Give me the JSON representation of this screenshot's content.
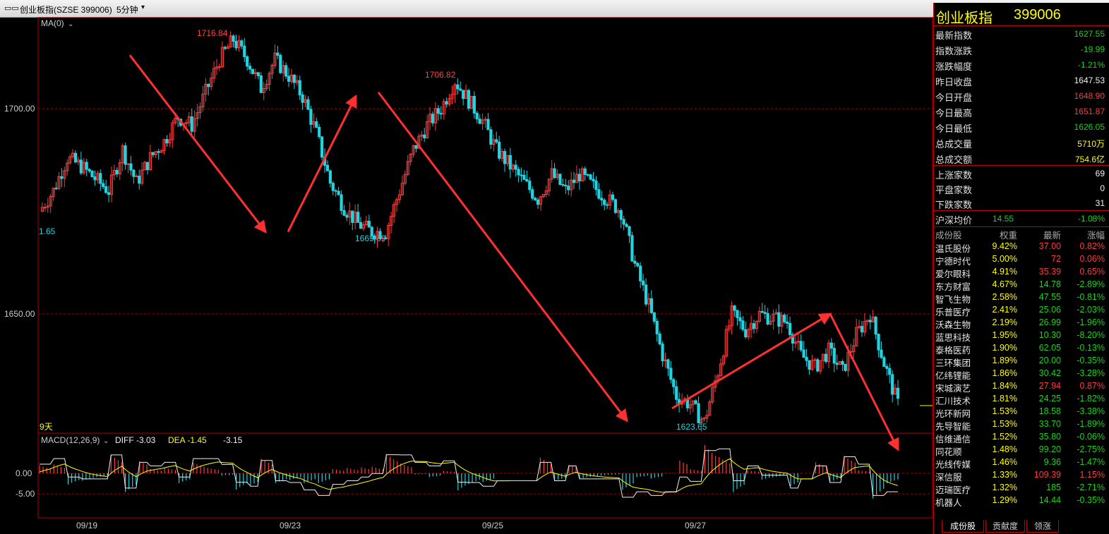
{
  "window": {
    "title": "创业板指(SZSE 399006)",
    "period": "5分钟"
  },
  "chart": {
    "ma_label": "MA(0)",
    "macd_label": "MACD(12,26,9)",
    "diff_label": "DIFF -3.03",
    "dea_label": "DEA -1.45",
    "macd_value": "-3.15",
    "span_label": "9天"
  },
  "chart_data": {
    "type": "candlestick",
    "price_axis": {
      "ticks": [
        "1700.00",
        "1650.00"
      ],
      "ylim": [
        1619,
        1732
      ]
    },
    "macd_axis": {
      "ticks": [
        "0.00",
        "-5.00"
      ]
    },
    "x_ticks": [
      "09/19",
      "09/23",
      "09/25",
      "09/27"
    ],
    "annotations": [
      {
        "text": "1716.84",
        "kind": "high"
      },
      {
        "text": "1669.89",
        "kind": "low"
      },
      {
        "text": "1706.82",
        "kind": "high"
      },
      {
        "text": "1623.65",
        "kind": "low"
      },
      {
        "text": "1.65",
        "kind": "left-edge"
      }
    ],
    "close_path": [
      1675,
      1680,
      1688,
      1686,
      1683,
      1680,
      1690,
      1682,
      1688,
      1692,
      1698,
      1696,
      1704,
      1712,
      1716.84,
      1712,
      1705,
      1712,
      1708,
      1703,
      1694,
      1682,
      1676,
      1672,
      1670,
      1669.89,
      1680,
      1690,
      1696,
      1700,
      1706.82,
      1702,
      1697,
      1690,
      1686,
      1682,
      1678,
      1684,
      1680,
      1684,
      1681,
      1678,
      1675,
      1662,
      1652,
      1640,
      1630,
      1628,
      1623.65,
      1636,
      1650,
      1646,
      1650,
      1649,
      1648,
      1640,
      1637,
      1641,
      1636,
      1645,
      1650,
      1638,
      1628
    ],
    "trend_arrows": [
      {
        "from": [
          4,
          1713
        ],
        "to": [
          10,
          1670
        ]
      },
      {
        "from": [
          11,
          1670
        ],
        "to": [
          14,
          1703
        ]
      },
      {
        "from": [
          15,
          1704
        ],
        "to": [
          26,
          1624
        ]
      },
      {
        "from": [
          28,
          1627
        ],
        "to": [
          35,
          1650
        ]
      },
      {
        "from": [
          35,
          1650
        ],
        "to": [
          38,
          1617
        ]
      }
    ]
  },
  "quote": {
    "name": "创业板指",
    "code": "399006",
    "fields": [
      {
        "label": "最新指数",
        "value": "1627.55",
        "color": "#19d419"
      },
      {
        "label": "指数涨跌",
        "value": "-19.99",
        "color": "#19d419"
      },
      {
        "label": "涨跌幅度",
        "value": "-1.21%",
        "color": "#19d419"
      },
      {
        "label": "昨日收盘",
        "value": "1647.53",
        "color": "#f0f0f0"
      },
      {
        "label": "今日开盘",
        "value": "1648.90",
        "color": "#ff3b3b"
      },
      {
        "label": "今日最高",
        "value": "1651.87",
        "color": "#ff3b3b"
      },
      {
        "label": "今日最低",
        "value": "1626.05",
        "color": "#19d419"
      },
      {
        "label": "总成交量",
        "value": "5710万",
        "color": "#ffff00"
      },
      {
        "label": "总成交额",
        "value": "754.6亿",
        "color": "#ffff00"
      }
    ],
    "breadth": [
      {
        "label": "上涨家数",
        "value": "69"
      },
      {
        "label": "平盘家数",
        "value": "0"
      },
      {
        "label": "下跌家数",
        "value": "31"
      }
    ],
    "avg": {
      "label": "沪深均价",
      "value": "14.55",
      "change": "-1.08%"
    }
  },
  "constituents": {
    "headers": [
      "成份股",
      "权重",
      "最新",
      "涨幅"
    ],
    "rows": [
      {
        "name": "温氏股份",
        "weight": "9.42%",
        "price": "37.00",
        "chg": "0.82%",
        "dir": "up"
      },
      {
        "name": "宁德时代",
        "weight": "5.00%",
        "price": "72",
        "chg": "0.06%",
        "dir": "up"
      },
      {
        "name": "爱尔眼科",
        "weight": "4.91%",
        "price": "35.39",
        "chg": "0.65%",
        "dir": "up"
      },
      {
        "name": "东方财富",
        "weight": "4.67%",
        "price": "14.78",
        "chg": "-2.89%",
        "dir": "dn"
      },
      {
        "name": "智飞生物",
        "weight": "2.58%",
        "price": "47.55",
        "chg": "-0.81%",
        "dir": "dn"
      },
      {
        "name": "乐普医疗",
        "weight": "2.41%",
        "price": "25.06",
        "chg": "-2.03%",
        "dir": "dn"
      },
      {
        "name": "沃森生物",
        "weight": "2.19%",
        "price": "26.99",
        "chg": "-1.96%",
        "dir": "dn"
      },
      {
        "name": "蓝思科技",
        "weight": "1.95%",
        "price": "10.30",
        "chg": "-8.20%",
        "dir": "dn"
      },
      {
        "name": "泰格医药",
        "weight": "1.90%",
        "price": "62.05",
        "chg": "-0.13%",
        "dir": "dn"
      },
      {
        "name": "三环集团",
        "weight": "1.89%",
        "price": "20.00",
        "chg": "-0.35%",
        "dir": "dn"
      },
      {
        "name": "亿纬锂能",
        "weight": "1.86%",
        "price": "30.42",
        "chg": "-3.28%",
        "dir": "dn"
      },
      {
        "name": "宋城演艺",
        "weight": "1.84%",
        "price": "27.94",
        "chg": "0.87%",
        "dir": "up"
      },
      {
        "name": "汇川技术",
        "weight": "1.81%",
        "price": "24.25",
        "chg": "-1.82%",
        "dir": "dn"
      },
      {
        "name": "光环新网",
        "weight": "1.53%",
        "price": "18.58",
        "chg": "-3.38%",
        "dir": "dn"
      },
      {
        "name": "先导智能",
        "weight": "1.53%",
        "price": "33.70",
        "chg": "-1.89%",
        "dir": "dn"
      },
      {
        "name": "信维通信",
        "weight": "1.52%",
        "price": "35.80",
        "chg": "-0.06%",
        "dir": "dn"
      },
      {
        "name": "同花顺",
        "weight": "1.48%",
        "price": "99.20",
        "chg": "-2.75%",
        "dir": "dn"
      },
      {
        "name": "光线传媒",
        "weight": "1.46%",
        "price": "9.36",
        "chg": "-1.47%",
        "dir": "dn"
      },
      {
        "name": "深信服",
        "weight": "1.33%",
        "price": "109.39",
        "chg": "1.15%",
        "dir": "up"
      },
      {
        "name": "迈瑞医疗",
        "weight": "1.32%",
        "price": "185",
        "chg": "-2.71%",
        "dir": "dn"
      },
      {
        "name": "机器人",
        "weight": "1.29%",
        "price": "14.44",
        "chg": "-0.35%",
        "dir": "dn"
      }
    ]
  },
  "tabs": [
    "成份股",
    "贡献度",
    "领涨"
  ],
  "colors": {
    "up": "#ff3b3b",
    "down": "#19d419",
    "grid": "#b00000",
    "cyan": "#22d3e0",
    "arrow": "#ff3030"
  }
}
